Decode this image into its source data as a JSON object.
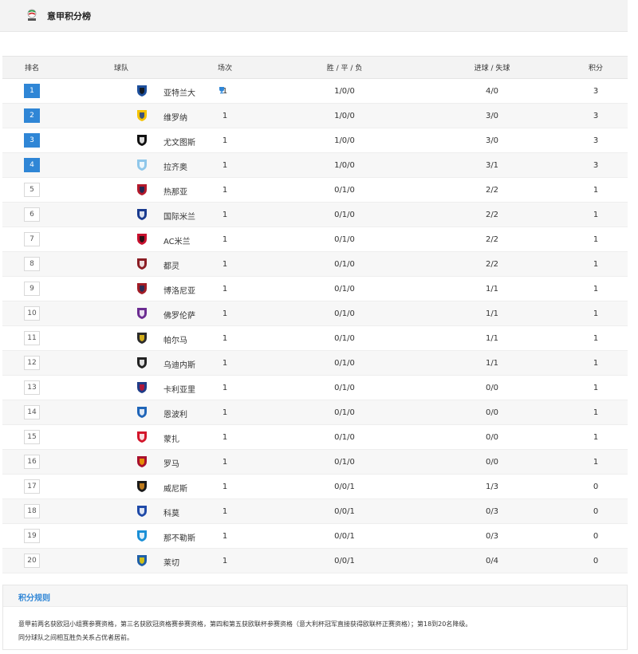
{
  "page": {
    "title": "意甲积分榜"
  },
  "columns": {
    "rank": "排名",
    "team": "球队",
    "played": "场次",
    "wdl": "胜 / 平 / 负",
    "goals": "进球 / 失球",
    "points": "积分"
  },
  "rows": [
    {
      "rank": "1",
      "team": "亚特兰大",
      "played": "1",
      "wdl": "1/0/0",
      "goals": "4/0",
      "points": "3",
      "crest_color": "#1d4f9c",
      "crest_color2": "#111111"
    },
    {
      "rank": "2",
      "team": "维罗纳",
      "played": "1",
      "wdl": "1/0/0",
      "goals": "3/0",
      "points": "3",
      "crest_color": "#f5c300",
      "crest_color2": "#1c3f8e"
    },
    {
      "rank": "3",
      "team": "尤文图斯",
      "played": "1",
      "wdl": "1/0/0",
      "goals": "3/0",
      "points": "3",
      "crest_color": "#111111",
      "crest_color2": "#ffffff"
    },
    {
      "rank": "4",
      "team": "拉齐奥",
      "played": "1",
      "wdl": "1/0/0",
      "goals": "3/1",
      "points": "3",
      "crest_color": "#8fc7ea",
      "crest_color2": "#ffffff"
    },
    {
      "rank": "5",
      "team": "热那亚",
      "played": "1",
      "wdl": "0/1/0",
      "goals": "2/2",
      "points": "1",
      "crest_color": "#b3192b",
      "crest_color2": "#0d2a57"
    },
    {
      "rank": "6",
      "team": "国际米兰",
      "played": "1",
      "wdl": "0/1/0",
      "goals": "2/2",
      "points": "1",
      "crest_color": "#1a3b8f",
      "crest_color2": "#ffffff"
    },
    {
      "rank": "7",
      "team": "AC米兰",
      "played": "1",
      "wdl": "0/1/0",
      "goals": "2/2",
      "points": "1",
      "crest_color": "#c8102e",
      "crest_color2": "#111111"
    },
    {
      "rank": "8",
      "team": "都灵",
      "played": "1",
      "wdl": "0/1/0",
      "goals": "2/2",
      "points": "1",
      "crest_color": "#8b1d24",
      "crest_color2": "#ffffff"
    },
    {
      "rank": "9",
      "team": "博洛尼亚",
      "played": "1",
      "wdl": "0/1/0",
      "goals": "1/1",
      "points": "1",
      "crest_color": "#a21c26",
      "crest_color2": "#1a2f5c"
    },
    {
      "rank": "10",
      "team": "佛罗伦萨",
      "played": "1",
      "wdl": "0/1/0",
      "goals": "1/1",
      "points": "1",
      "crest_color": "#6b2c91",
      "crest_color2": "#ffffff"
    },
    {
      "rank": "11",
      "team": "帕尔马",
      "played": "1",
      "wdl": "0/1/0",
      "goals": "1/1",
      "points": "1",
      "crest_color": "#2b2b2b",
      "crest_color2": "#f0c419"
    },
    {
      "rank": "12",
      "team": "乌迪内斯",
      "played": "1",
      "wdl": "0/1/0",
      "goals": "1/1",
      "points": "1",
      "crest_color": "#222222",
      "crest_color2": "#ffffff"
    },
    {
      "rank": "13",
      "team": "卡利亚里",
      "played": "1",
      "wdl": "0/1/0",
      "goals": "0/0",
      "points": "1",
      "crest_color": "#1f3c88",
      "crest_color2": "#c8102e"
    },
    {
      "rank": "14",
      "team": "恩波利",
      "played": "1",
      "wdl": "0/1/0",
      "goals": "0/0",
      "points": "1",
      "crest_color": "#1f65b8",
      "crest_color2": "#ffffff"
    },
    {
      "rank": "15",
      "team": "蒙扎",
      "played": "1",
      "wdl": "0/1/0",
      "goals": "0/0",
      "points": "1",
      "crest_color": "#d3162b",
      "crest_color2": "#ffffff"
    },
    {
      "rank": "16",
      "team": "罗马",
      "played": "1",
      "wdl": "0/1/0",
      "goals": "0/0",
      "points": "1",
      "crest_color": "#a8102e",
      "crest_color2": "#f0a500"
    },
    {
      "rank": "17",
      "team": "威尼斯",
      "played": "1",
      "wdl": "0/0/1",
      "goals": "1/3",
      "points": "0",
      "crest_color": "#1b1b1b",
      "crest_color2": "#d98b1c"
    },
    {
      "rank": "18",
      "team": "科莫",
      "played": "1",
      "wdl": "0/0/1",
      "goals": "0/3",
      "points": "0",
      "crest_color": "#1f4aa8",
      "crest_color2": "#ffffff"
    },
    {
      "rank": "19",
      "team": "那不勒斯",
      "played": "1",
      "wdl": "0/0/1",
      "goals": "0/3",
      "points": "0",
      "crest_color": "#1a8fd6",
      "crest_color2": "#ffffff"
    },
    {
      "rank": "20",
      "team": "莱切",
      "played": "1",
      "wdl": "0/0/1",
      "goals": "0/4",
      "points": "0",
      "crest_color": "#1f5fa8",
      "crest_color2": "#f0d000"
    }
  ],
  "highlight_color": "#2f86d6",
  "rules": {
    "title": "积分规则",
    "line1": "意甲前两名获欧冠小组赛参赛资格，第三名获欧冠资格赛参赛资格，第四和第五获欧联杯参赛资格（意大利杯冠军直接获得欧联杯正赛资格）；第18到20名降级。",
    "line2": "同分球队之间相互胜负关系占优者居前。"
  },
  "icons": {
    "league_logo": "serie-a-logo-icon",
    "trophy": "trophy-icon"
  }
}
